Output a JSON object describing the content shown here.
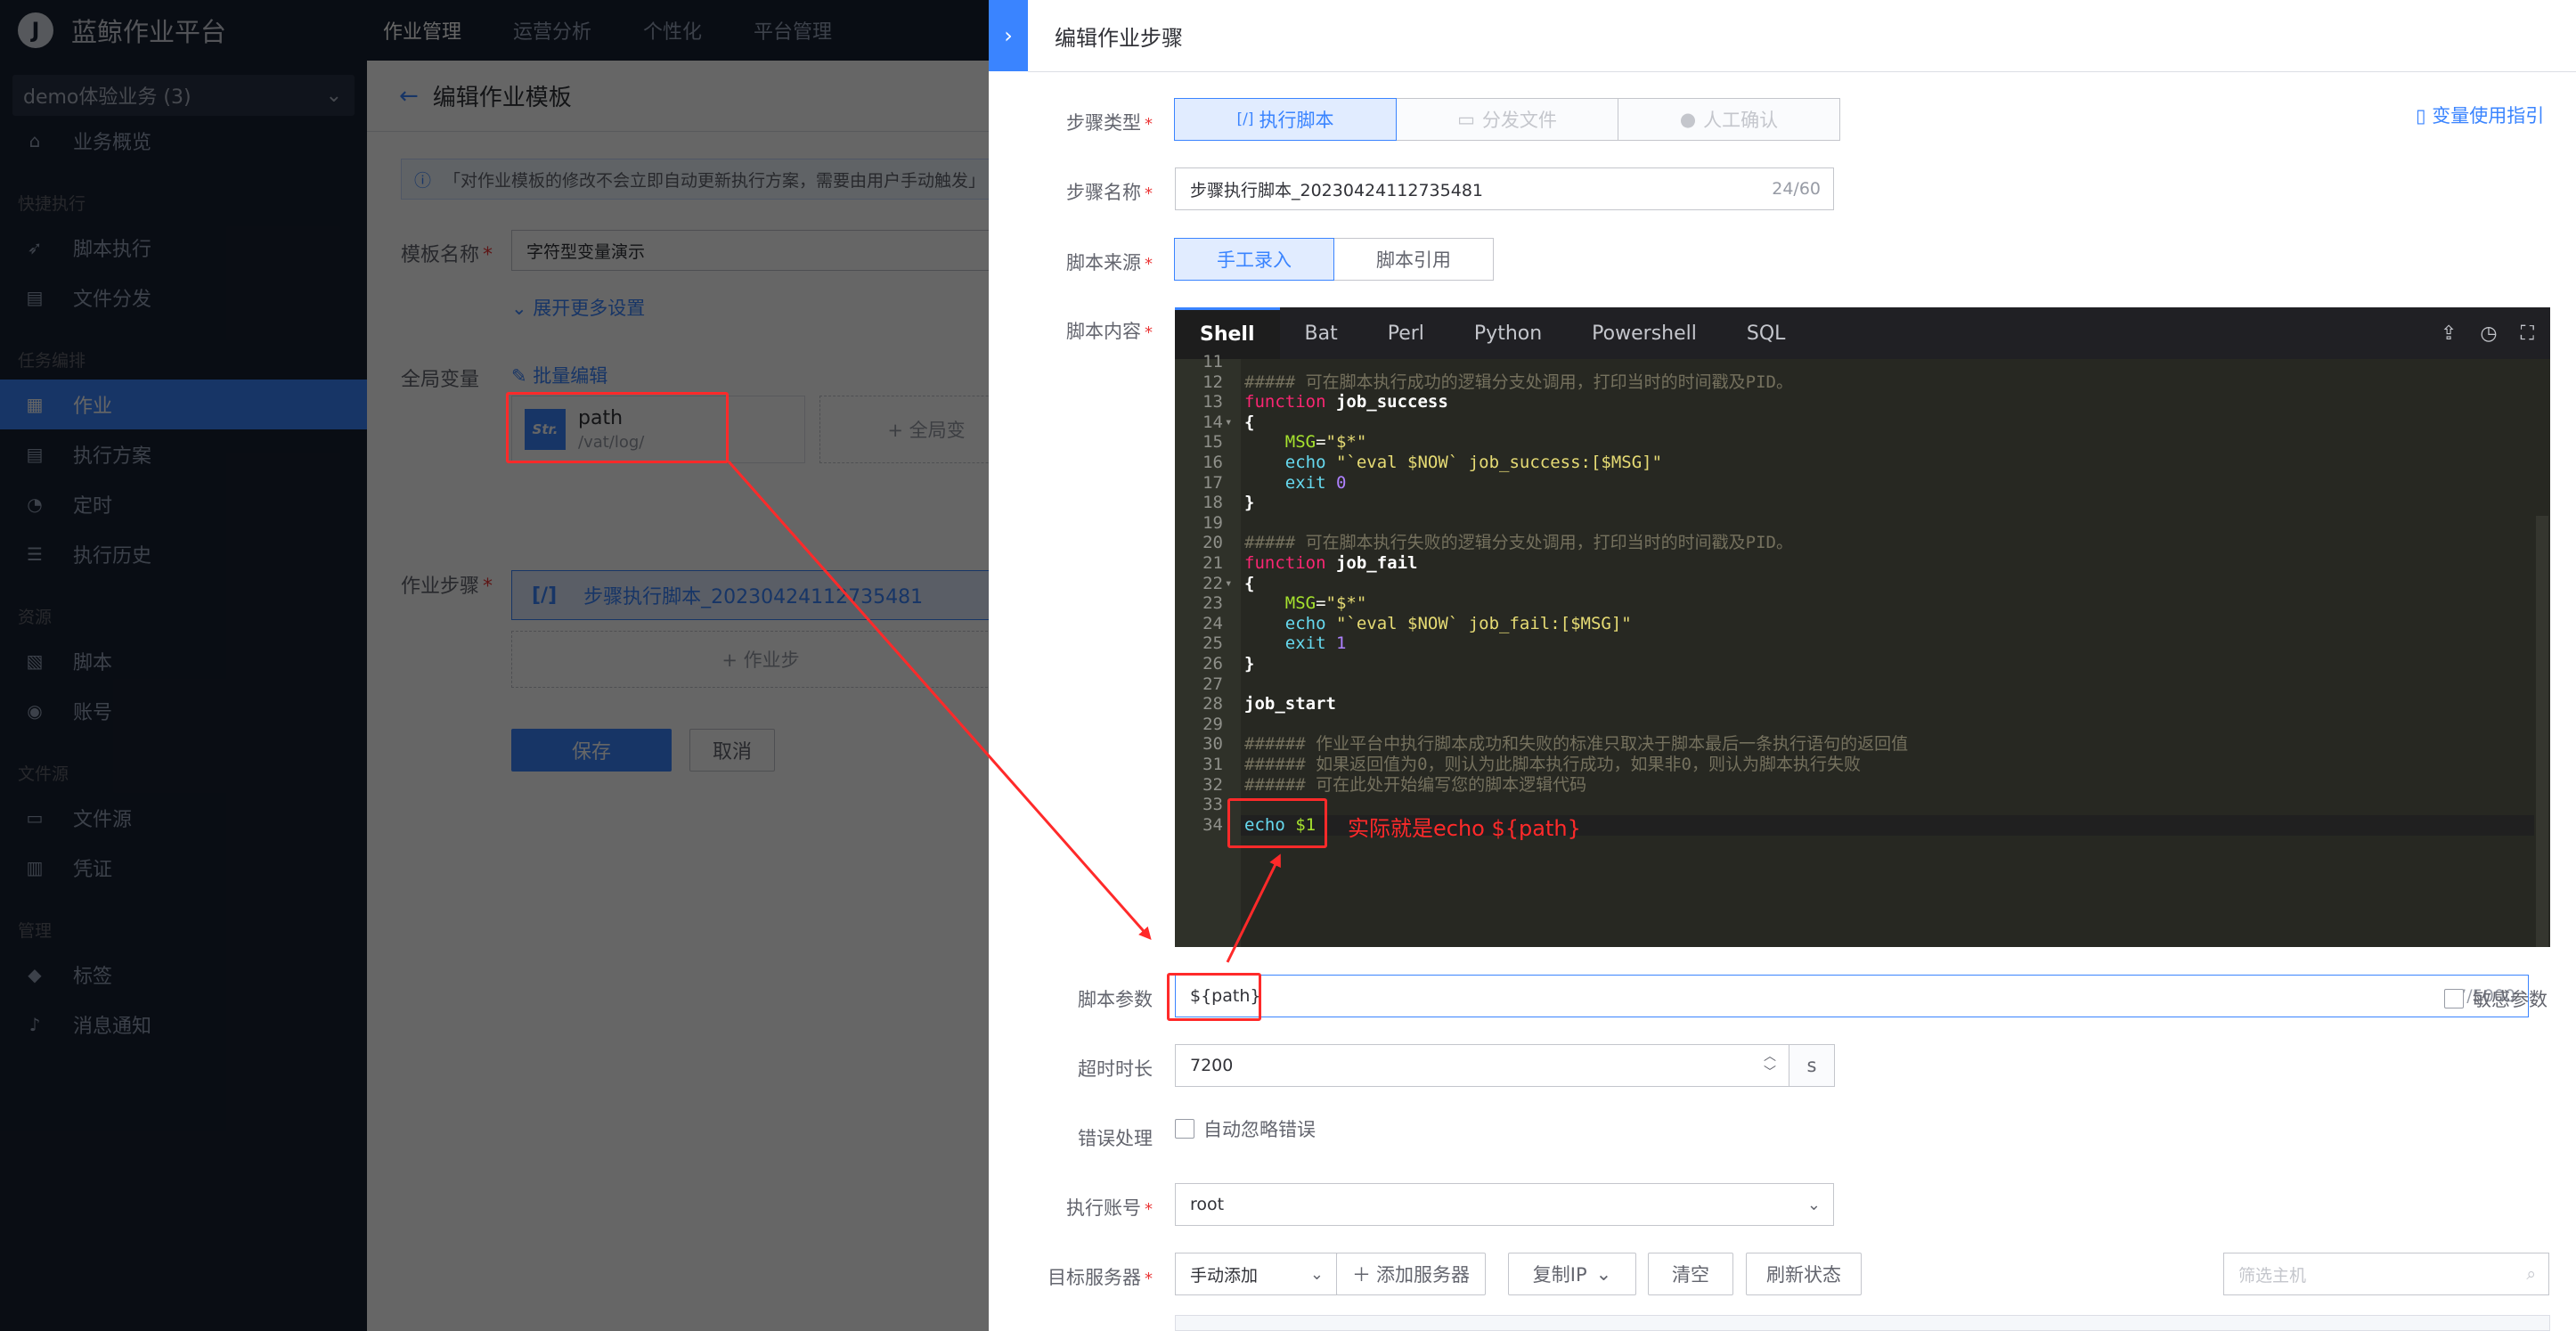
{
  "app": {
    "logo_letter": "J",
    "title": "蓝鲸作业平台"
  },
  "top_nav": [
    {
      "label": "作业管理",
      "active": true
    },
    {
      "label": "运营分析",
      "active": false
    },
    {
      "label": "个性化",
      "active": false
    },
    {
      "label": "平台管理",
      "active": false
    }
  ],
  "sidebar": {
    "business": "demo体验业务 (3)",
    "items": [
      {
        "label": "业务概览",
        "icon": "home-icon"
      },
      {
        "group": "快捷执行"
      },
      {
        "label": "脚本执行",
        "icon": "rocket-icon"
      },
      {
        "label": "文件分发",
        "icon": "file-icon"
      },
      {
        "group": "任务编排"
      },
      {
        "label": "作业",
        "icon": "job-icon",
        "active": true
      },
      {
        "label": "执行方案",
        "icon": "plan-icon"
      },
      {
        "label": "定时",
        "icon": "clock-icon"
      },
      {
        "label": "执行历史",
        "icon": "history-icon"
      },
      {
        "group": "资源"
      },
      {
        "label": "脚本",
        "icon": "script-icon"
      },
      {
        "label": "账号",
        "icon": "account-icon"
      },
      {
        "group": "文件源"
      },
      {
        "label": "文件源",
        "icon": "folder-icon"
      },
      {
        "label": "凭证",
        "icon": "credential-icon"
      },
      {
        "group": "管理"
      },
      {
        "label": "标签",
        "icon": "tag-icon"
      },
      {
        "label": "消息通知",
        "icon": "bell-icon"
      }
    ]
  },
  "main": {
    "title": "编辑作业模板",
    "notice": "「对作业模板的修改不会立即自动更新执行方案，需要由用户手动触发」",
    "template_name_label": "模板名称",
    "template_name_value": "字符型变量演示",
    "expand_more": "展开更多设置",
    "global_vars_label": "全局变量",
    "batch_edit": "批量编辑",
    "variable": {
      "type_badge": "Str.",
      "name": "path",
      "value": "/vat/log/"
    },
    "add_global_var": "+ 全局变",
    "steps_label": "作业步骤",
    "step_item": "步骤执行脚本_20230424112735481",
    "add_step": "+ 作业步",
    "save": "保存",
    "cancel": "取消"
  },
  "panel": {
    "title": "编辑作业步骤",
    "guide_link": "变量使用指引",
    "step_type_label": "步骤类型",
    "step_types": [
      {
        "label": "执行脚本",
        "active": true
      },
      {
        "label": "分发文件",
        "active": false
      },
      {
        "label": "人工确认",
        "active": false
      }
    ],
    "step_name_label": "步骤名称",
    "step_name_value": "步骤执行脚本_20230424112735481",
    "step_name_count": "24/60",
    "script_source_label": "脚本来源",
    "script_sources": [
      {
        "label": "手工录入",
        "active": true
      },
      {
        "label": "脚本引用",
        "active": false
      }
    ],
    "script_content_label": "脚本内容",
    "editor_tabs": [
      "Shell",
      "Bat",
      "Perl",
      "Python",
      "Powershell",
      "SQL"
    ],
    "editor_active_tab": "Shell",
    "annotation": "实际就是echo ${path}",
    "script_params_label": "脚本参数",
    "script_params_value": "${path}",
    "script_params_count": "7/5000",
    "sensitive_label": "敏感参数",
    "timeout_label": "超时时长",
    "timeout_value": "7200",
    "timeout_unit": "s",
    "error_label": "错误处理",
    "error_option": "自动忽略错误",
    "account_label": "执行账号",
    "account_value": "root",
    "target_label": "目标服务器",
    "target_mode": "手动添加",
    "add_server": "添加服务器",
    "copy_ip": "复制IP",
    "clear": "清空",
    "refresh": "刷新状态",
    "filter_placeholder": "筛选主机"
  },
  "code_lines": [
    {
      "n": "11",
      "fold": "",
      "html": ""
    },
    {
      "n": "12",
      "fold": "",
      "html": "<span class='c-cmt'>##### 可在脚本执行成功的逻辑分支处调用，打印当时的时间戳及PID。</span>"
    },
    {
      "n": "13",
      "fold": "",
      "html": "<span class='c-kw'>function</span> <span class='c-def'>job_success</span>"
    },
    {
      "n": "14",
      "fold": "▾",
      "html": "<span class='c-def'>{</span>"
    },
    {
      "n": "15",
      "fold": "",
      "html": "    <span class='c-var'>MSG</span>=<span class='c-str'>\"$*\"</span>"
    },
    {
      "n": "16",
      "fold": "",
      "html": "    <span class='c-fn'>echo</span> <span class='c-str'>\"`eval $NOW` job_success:[$MSG]\"</span>"
    },
    {
      "n": "17",
      "fold": "",
      "html": "    <span class='c-fn'>exit</span> <span class='c-num'>0</span>"
    },
    {
      "n": "18",
      "fold": "",
      "html": "<span class='c-def'>}</span>"
    },
    {
      "n": "19",
      "fold": "",
      "html": ""
    },
    {
      "n": "20",
      "fold": "",
      "html": "<span class='c-cmt'>##### 可在脚本执行失败的逻辑分支处调用，打印当时的时间戳及PID。</span>"
    },
    {
      "n": "21",
      "fold": "",
      "html": "<span class='c-kw'>function</span> <span class='c-def'>job_fail</span>"
    },
    {
      "n": "22",
      "fold": "▾",
      "html": "<span class='c-def'>{</span>"
    },
    {
      "n": "23",
      "fold": "",
      "html": "    <span class='c-var'>MSG</span>=<span class='c-str'>\"$*\"</span>"
    },
    {
      "n": "24",
      "fold": "",
      "html": "    <span class='c-fn'>echo</span> <span class='c-str'>\"`eval $NOW` job_fail:[$MSG]\"</span>"
    },
    {
      "n": "25",
      "fold": "",
      "html": "    <span class='c-fn'>exit</span> <span class='c-num'>1</span>"
    },
    {
      "n": "26",
      "fold": "",
      "html": "<span class='c-def'>}</span>"
    },
    {
      "n": "27",
      "fold": "",
      "html": ""
    },
    {
      "n": "28",
      "fold": "",
      "html": "<span class='c-def'>job_start</span>"
    },
    {
      "n": "29",
      "fold": "",
      "html": ""
    },
    {
      "n": "30",
      "fold": "",
      "html": "<span class='c-cmt'>###### 作业平台中执行脚本成功和失败的标准只取决于脚本最后一条执行语句的返回值</span>"
    },
    {
      "n": "31",
      "fold": "",
      "html": "<span class='c-cmt'>###### 如果返回值为0，则认为此脚本执行成功，如果非0，则认为脚本执行失败</span>"
    },
    {
      "n": "32",
      "fold": "",
      "html": "<span class='c-cmt'>###### 可在此处开始编写您的脚本逻辑代码</span>"
    },
    {
      "n": "33",
      "fold": "",
      "html": ""
    },
    {
      "n": "34",
      "fold": "",
      "html": "<span class='c-fn'>echo</span> <span class='c-var'>$1</span>"
    }
  ],
  "colors": {
    "accent": "#3a84ff",
    "annotation": "#ff2a2a",
    "sidebar_bg": "#182132"
  }
}
